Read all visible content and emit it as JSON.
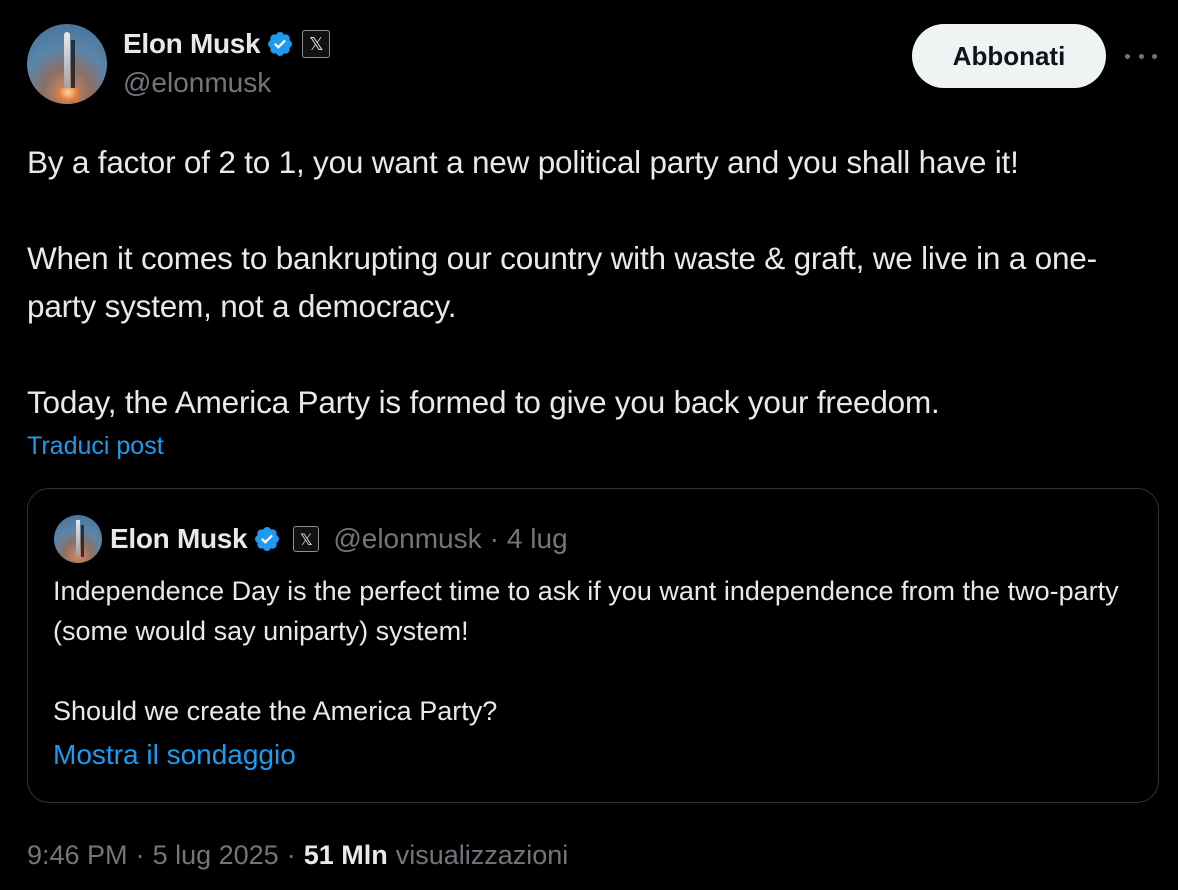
{
  "author": {
    "display_name": "Elon Musk",
    "handle": "@elonmusk",
    "affiliate_badge": "𝕏"
  },
  "header": {
    "subscribe_label": "Abbonati"
  },
  "tweet": {
    "paragraphs": [
      "By a factor of 2 to 1, you want a new political party and you shall have it!",
      "When it comes to bankrupting our country with waste & graft, we live in a one-party system, not a democracy.",
      "Today, the America Party is formed to give you back your freedom."
    ],
    "translate_label": "Traduci post"
  },
  "quote": {
    "display_name": "Elon Musk",
    "affiliate_badge": "𝕏",
    "handle": "@elonmusk",
    "separator": "·",
    "date": "4 lug",
    "paragraphs": [
      "Independence Day is the perfect time to ask if you want independence from the two-party (some would say uniparty) system!",
      "Should we create the America Party?"
    ],
    "poll_link": "Mostra il sondaggio"
  },
  "meta": {
    "time": "9:46 PM",
    "separator": "·",
    "date": "5 lug 2025",
    "views_count": "51 Mln",
    "views_label": "visualizzazioni"
  },
  "colors": {
    "background": "#000000",
    "text": "#e7e9ea",
    "muted": "#71767b",
    "link": "#1d9bf0",
    "verified": "#1d9bf0"
  }
}
